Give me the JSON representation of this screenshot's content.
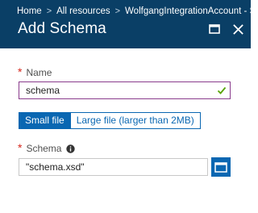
{
  "breadcrumb": {
    "items": [
      "Home",
      "All resources",
      "WolfgangIntegrationAccount - S"
    ],
    "separator": ">"
  },
  "blade": {
    "title": "Add Schema",
    "maximize_icon": "maximize-icon",
    "close_icon": "close-icon"
  },
  "form": {
    "name": {
      "label": "Name",
      "required_mark": "*",
      "value": "schema",
      "valid_icon": "checkmark-icon"
    },
    "file_size_toggle": {
      "options": [
        "Small file",
        "Large file (larger than 2MB)"
      ],
      "selected": "Small file"
    },
    "schema": {
      "label": "Schema",
      "required_mark": "*",
      "info_icon": "info-icon",
      "value": "\"schema.xsd\"",
      "browse_icon": "folder-icon"
    }
  },
  "colors": {
    "header_bg": "#0a3f66",
    "accent": "#0a67b2",
    "required": "#d6271d",
    "valid": "#57a300",
    "focus_border": "#8a3c8c"
  }
}
